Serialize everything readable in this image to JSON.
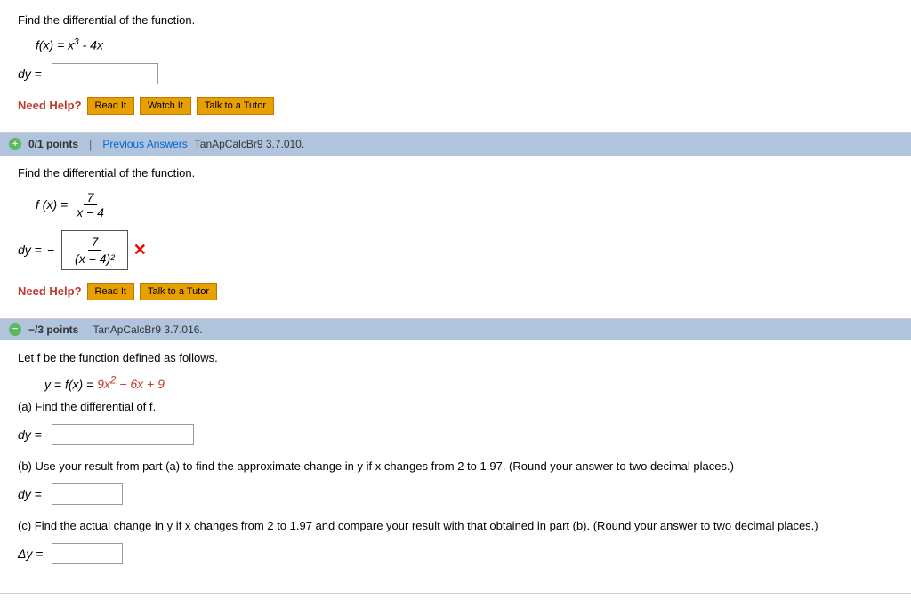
{
  "sections": [
    {
      "id": "section1",
      "showHeader": false,
      "questionText": "Find the differential of the function.",
      "functionLatex": "f(x) = x³ - 4x",
      "functionDisplay": {
        "prefix": "f(x) = x",
        "superscript": "3",
        "suffix": " - 4x"
      },
      "answerLabel": "dy =",
      "inputSize": "short",
      "needHelp": {
        "label": "Need Help?",
        "buttons": [
          "Read It",
          "Watch It",
          "Talk to a Tutor"
        ]
      }
    },
    {
      "id": "section2",
      "showHeader": true,
      "headerPoints": "0/1 points",
      "headerSeparator": "|",
      "headerPrevAnswers": "Previous Answers",
      "headerCourseCode": "TanApCalcBr9 3.7.010.",
      "questionText": "Find the differential of the function.",
      "functionDisplay": {
        "italic": true,
        "text": "f (x) = 7 / (x − 4)"
      },
      "answerLabel": "dy =",
      "answerHasFraction": true,
      "answerNumerator": "7",
      "answerDenominator": "(x − 4)²",
      "answerWrong": true,
      "needHelp": {
        "label": "Need Help?",
        "buttons": [
          "Read It",
          "Talk to a Tutor"
        ]
      }
    },
    {
      "id": "section3",
      "showHeader": true,
      "headerPoints": "−/3 points",
      "headerCourseCode": "TanApCalcBr9 3.7.016.",
      "questionText": "Let f be the function defined as follows.",
      "functionDisplay": {
        "equation": "y = f(x) = 9x² − 6x + 9"
      },
      "partA": {
        "label": "(a) Find the differential of f.",
        "answerLabel": "dy =",
        "inputSize": "medium"
      },
      "partB": {
        "label": "(b) Use your result from part (a) to find the approximate change in y if x changes from 2 to 1.97. (Round your answer to two decimal places.)",
        "answerLabel": "dy =",
        "inputSize": "tiny"
      },
      "partC": {
        "label": "(c) Find the actual change in y if x changes from 2 to 1.97 and compare your result with that obtained in part (b). (Round your answer to two decimal places.)",
        "answerLabel": "Δy =",
        "inputSize": "tiny"
      }
    }
  ],
  "ui": {
    "needHelpLabel": "Need Help?",
    "readItBtn": "Read It",
    "watchItBtn": "Watch It",
    "talkTutorBtn": "Talk to a Tutor",
    "prevAnswersText": "Previous Answers",
    "xMark": "✕"
  }
}
